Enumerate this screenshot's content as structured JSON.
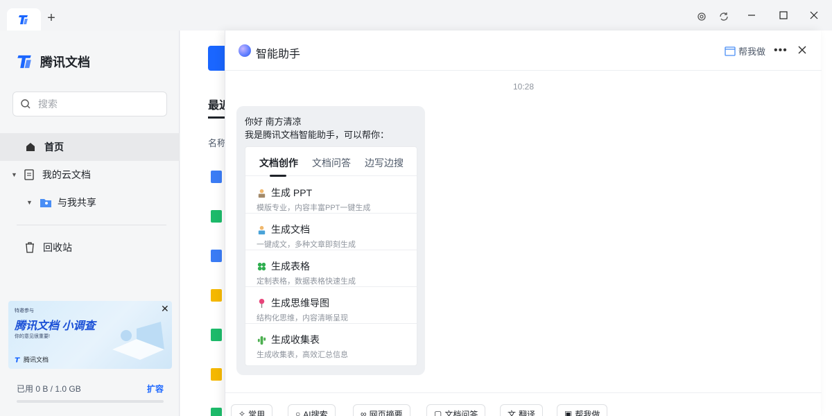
{
  "app": {
    "tab_icon": "tencent-docs-logo-icon",
    "new_tab": "+"
  },
  "sidebar": {
    "brand": "腾讯文档",
    "search_placeholder": "搜索",
    "nav": [
      {
        "label": "首页",
        "icon": "home-icon"
      },
      {
        "label": "我的云文档",
        "icon": "doc-icon"
      },
      {
        "label": "与我共享",
        "icon": "shared-folder-icon"
      },
      {
        "label": "回收站",
        "icon": "trash-icon"
      }
    ],
    "banner": {
      "small": "特邀参与",
      "title": "腾讯文档 小调查",
      "sub": "你的意见很重要!",
      "brand": "腾讯文档"
    },
    "storage": {
      "used": "已用 0 B / 1.0 GB",
      "expand": "扩容",
      "fill": 0
    }
  },
  "main": {
    "recent": "最近",
    "col_name": "名称"
  },
  "assistant": {
    "title": "智能助手",
    "help_label": "帮我做",
    "time": "10:28",
    "greet_line1": "你好 南方清凉",
    "greet_line2": "我是腾讯文档智能助手，可以帮你：",
    "tabs": [
      "文档创作",
      "文档问答",
      "边写边搜"
    ],
    "options": [
      {
        "title": "生成 PPT",
        "desc": "模版专业，内容丰富PPT一键生成",
        "icon": "presenter-icon"
      },
      {
        "title": "生成文档",
        "desc": "一键成文，多种文章即刻生成",
        "icon": "writer-icon"
      },
      {
        "title": "生成表格",
        "desc": "定制表格，数据表格快速生成",
        "icon": "clover-icon"
      },
      {
        "title": "生成思维导图",
        "desc": "结构化思维，内容清晰呈现",
        "icon": "pin-icon"
      },
      {
        "title": "生成收集表",
        "desc": "生成收集表，高效汇总信息",
        "icon": "cactus-icon"
      }
    ],
    "chips": [
      {
        "label": "常用",
        "icon": "magic-wand-icon"
      },
      {
        "label": "AI搜索",
        "icon": "search-icon"
      },
      {
        "label": "网页摘要",
        "icon": "link-icon"
      },
      {
        "label": "文档问答",
        "icon": "doc-qa-icon"
      },
      {
        "label": "翻译",
        "icon": "translate-icon"
      },
      {
        "label": "帮我做",
        "icon": "help-do-icon"
      }
    ]
  },
  "colors": {
    "accent": "#1a66ff",
    "sidebar_bg": "#f5f6f7",
    "bubble_bg": "#eef0f3"
  }
}
